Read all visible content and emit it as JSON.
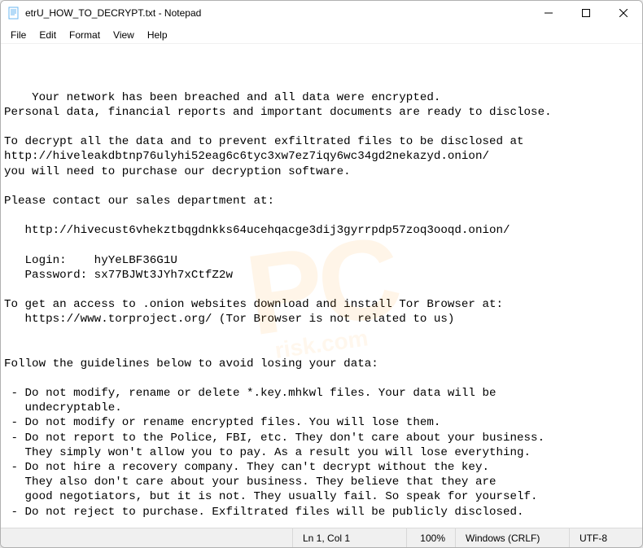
{
  "window": {
    "title": "etrU_HOW_TO_DECRYPT.txt - Notepad"
  },
  "menu": {
    "file": "File",
    "edit": "Edit",
    "format": "Format",
    "view": "View",
    "help": "Help"
  },
  "statusbar": {
    "position": "Ln 1, Col 1",
    "zoom": "100%",
    "line_ending": "Windows (CRLF)",
    "encoding": "UTF-8"
  },
  "document": {
    "text": "Your network has been breached and all data were encrypted.\nPersonal data, financial reports and important documents are ready to disclose.\n\nTo decrypt all the data and to prevent exfiltrated files to be disclosed at\nhttp://hiveleakdbtnp76ulyhi52eag6c6tyc3xw7ez7iqy6wc34gd2nekazyd.onion/\nyou will need to purchase our decryption software.\n\nPlease contact our sales department at:\n\n   http://hivecust6vhekztbqgdnkks64ucehqacge3dij3gyrrpdp57zoq3ooqd.onion/\n\n   Login:    hyYeLBF36G1U\n   Password: sx77BJWt3JYh7xCtfZ2w\n\nTo get an access to .onion websites download and install Tor Browser at:\n   https://www.torproject.org/ (Tor Browser is not related to us)\n\n\nFollow the guidelines below to avoid losing your data:\n\n - Do not modify, rename or delete *.key.mhkwl files. Your data will be\n   undecryptable.\n - Do not modify or rename encrypted files. You will lose them.\n - Do not report to the Police, FBI, etc. They don't care about your business.\n   They simply won't allow you to pay. As a result you will lose everything.\n - Do not hire a recovery company. They can't decrypt without the key.\n   They also don't care about your business. They believe that they are\n   good negotiators, but it is not. They usually fail. So speak for yourself.\n - Do not reject to purchase. Exfiltrated files will be publicly disclosed."
  }
}
